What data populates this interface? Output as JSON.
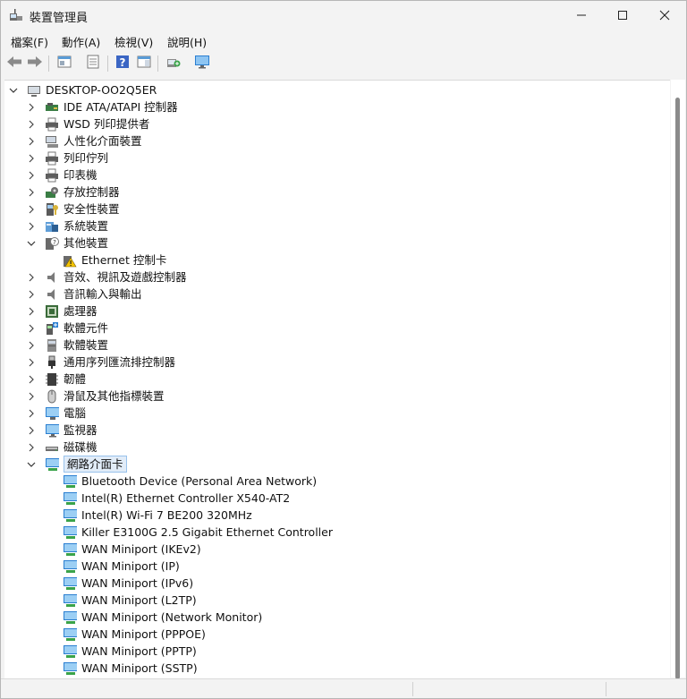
{
  "window": {
    "title": "裝置管理員",
    "icon": "device-manager-icon"
  },
  "menubar": {
    "file": "檔案(F)",
    "action": "動作(A)",
    "view": "檢視(V)",
    "help": "說明(H)"
  },
  "toolbar": {
    "buttons": [
      "back-arrow-icon",
      "forward-arrow-icon",
      "properties-icon",
      "list-view-icon",
      "help-icon",
      "action-pane-icon",
      "scan-hardware-icon",
      "display-icon"
    ]
  },
  "tree": {
    "root": "DESKTOP-OO2Q5ER",
    "items": [
      {
        "label": "IDE ATA/ATAPI 控制器",
        "icon": "ide-controller-icon",
        "expanded": false
      },
      {
        "label": "WSD 列印提供者",
        "icon": "printer-icon",
        "expanded": false
      },
      {
        "label": "人性化介面裝置",
        "icon": "hid-icon",
        "expanded": false
      },
      {
        "label": "列印佇列",
        "icon": "printer-icon",
        "expanded": false
      },
      {
        "label": "印表機",
        "icon": "printer-icon",
        "expanded": false
      },
      {
        "label": "存放控制器",
        "icon": "storage-controller-icon",
        "expanded": false
      },
      {
        "label": "安全性裝置",
        "icon": "security-device-icon",
        "expanded": false
      },
      {
        "label": "系統裝置",
        "icon": "system-device-icon",
        "expanded": false
      },
      {
        "label": "其他裝置",
        "icon": "other-device-icon",
        "expanded": true,
        "children": [
          {
            "label": "Ethernet 控制卡",
            "icon": "warning-device-icon"
          }
        ]
      },
      {
        "label": "音效、視訊及遊戲控制器",
        "icon": "speaker-icon",
        "expanded": false
      },
      {
        "label": "音訊輸入與輸出",
        "icon": "speaker-icon",
        "expanded": false
      },
      {
        "label": "處理器",
        "icon": "processor-icon",
        "expanded": false
      },
      {
        "label": "軟體元件",
        "icon": "software-component-icon",
        "expanded": false
      },
      {
        "label": "軟體裝置",
        "icon": "software-device-icon",
        "expanded": false
      },
      {
        "label": "通用序列匯流排控制器",
        "icon": "usb-icon",
        "expanded": false
      },
      {
        "label": "韌體",
        "icon": "firmware-icon",
        "expanded": false
      },
      {
        "label": "滑鼠及其他指標裝置",
        "icon": "mouse-icon",
        "expanded": false
      },
      {
        "label": "電腦",
        "icon": "computer-icon",
        "expanded": false
      },
      {
        "label": "監視器",
        "icon": "monitor-icon",
        "expanded": false
      },
      {
        "label": "磁碟機",
        "icon": "disk-drive-icon",
        "expanded": false
      },
      {
        "label": "網路介面卡",
        "icon": "network-adapter-icon",
        "expanded": true,
        "selected": true,
        "children": [
          {
            "label": "Bluetooth Device (Personal Area Network)",
            "icon": "network-adapter-icon"
          },
          {
            "label": "Intel(R) Ethernet Controller X540-AT2",
            "icon": "network-adapter-icon"
          },
          {
            "label": "Intel(R) Wi-Fi 7 BE200 320MHz",
            "icon": "network-adapter-icon"
          },
          {
            "label": "Killer E3100G 2.5 Gigabit Ethernet Controller",
            "icon": "network-adapter-icon"
          },
          {
            "label": "WAN Miniport (IKEv2)",
            "icon": "network-adapter-icon"
          },
          {
            "label": "WAN Miniport (IP)",
            "icon": "network-adapter-icon"
          },
          {
            "label": "WAN Miniport (IPv6)",
            "icon": "network-adapter-icon"
          },
          {
            "label": "WAN Miniport (L2TP)",
            "icon": "network-adapter-icon"
          },
          {
            "label": "WAN Miniport (Network Monitor)",
            "icon": "network-adapter-icon"
          },
          {
            "label": "WAN Miniport (PPPOE)",
            "icon": "network-adapter-icon"
          },
          {
            "label": "WAN Miniport (PPTP)",
            "icon": "network-adapter-icon"
          },
          {
            "label": "WAN Miniport (SSTP)",
            "icon": "network-adapter-icon"
          }
        ]
      }
    ]
  },
  "colors": {
    "selection_bg": "#e1ecf8",
    "selection_border": "#99c2ec",
    "warning": "#f5c400",
    "network_blue": "#2b7fd1",
    "network_green": "#3aa34a"
  }
}
